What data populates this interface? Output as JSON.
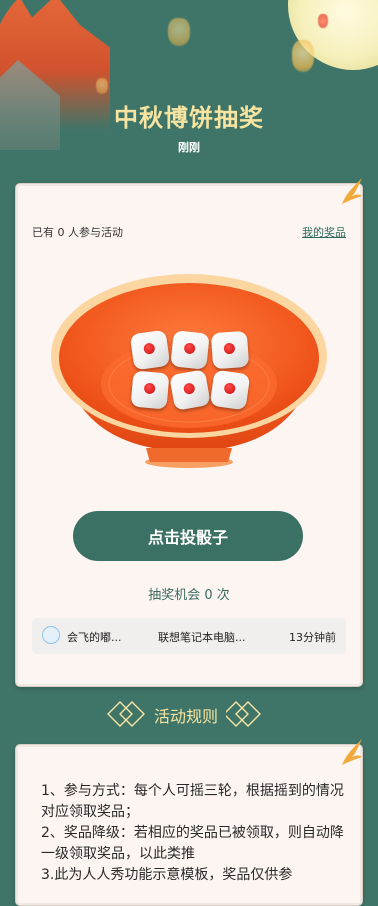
{
  "header": {
    "title": "中秋博饼抽奖",
    "subtitle": "刚刚"
  },
  "game": {
    "participants_text": "已有 0 人参与活动",
    "my_prizes_link": "我的奖品",
    "roll_button": "点击投骰子",
    "chances_text": "抽奖机会 0 次",
    "dice_count": 6
  },
  "winner": {
    "name": "会飞的嘟...",
    "prize": "联想笔记本电脑...",
    "time": "13分钟前"
  },
  "rules": {
    "heading": "活动规则",
    "lines": [
      "1、参与方式：每个人可摇三轮，根据摇到的情况对应领取奖品；",
      "2、奖品降级：若相应的奖品已被领取，则自动降一级领取奖品，以此类推",
      "3.此为人人秀功能示意模板，奖品仅供参"
    ]
  },
  "colors": {
    "background": "#3f7568",
    "accent_gold": "#f7e4a1",
    "button": "#3b7064",
    "bowl": "#f25a1f"
  }
}
